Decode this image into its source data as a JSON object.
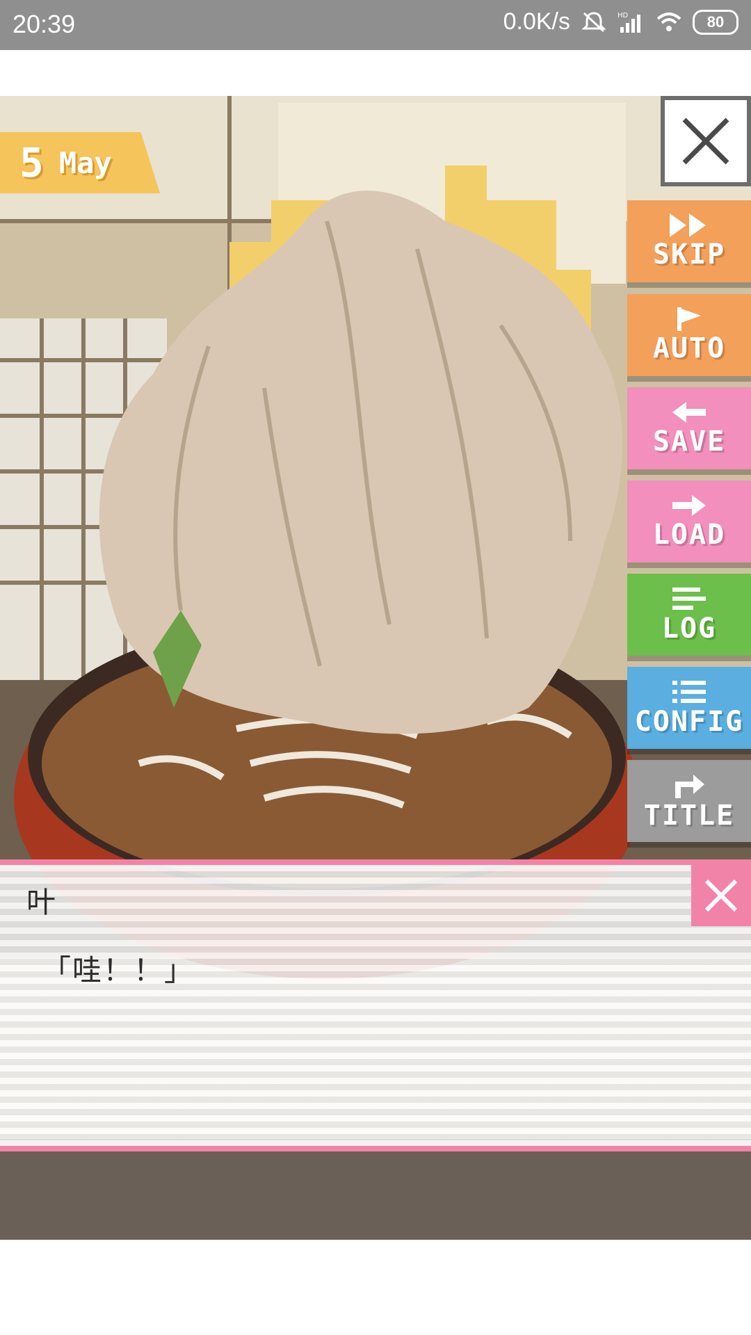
{
  "status_bar": {
    "time": "20:39",
    "net_speed": "0.0K/s",
    "battery": "80",
    "hd_label": "HD"
  },
  "game": {
    "date": {
      "day": "5",
      "month": "May"
    },
    "menu": [
      {
        "id": "skip",
        "label": "SKIP",
        "icon": "fast-forward-icon",
        "color": "#f2a05a"
      },
      {
        "id": "auto",
        "label": "AUTO",
        "icon": "play-flag-icon",
        "color": "#f2a05a"
      },
      {
        "id": "save",
        "label": "SAVE",
        "icon": "arrow-left-icon",
        "color": "#f28fbc"
      },
      {
        "id": "load",
        "label": "LOAD",
        "icon": "arrow-right-icon",
        "color": "#f28fbc"
      },
      {
        "id": "log",
        "label": "LOG",
        "icon": "lines-icon",
        "color": "#6cbf4a"
      },
      {
        "id": "config",
        "label": "CONFIG",
        "icon": "list-icon",
        "color": "#5aaee0"
      },
      {
        "id": "title",
        "label": "TITLE",
        "icon": "turn-right-arrow-icon",
        "color": "#9c9c9c"
      }
    ]
  },
  "dialog": {
    "speaker": "叶",
    "text": "「哇！！」"
  }
}
